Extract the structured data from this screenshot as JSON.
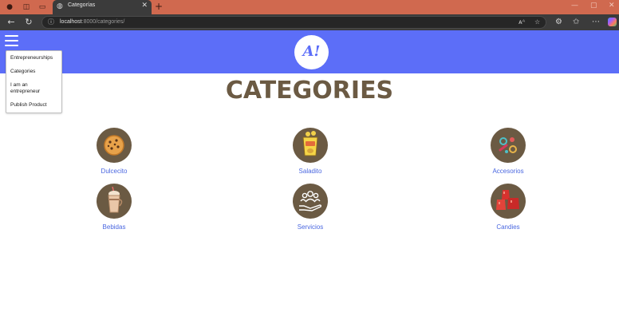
{
  "browser": {
    "tab_title": "Categorías",
    "url_host": "localhost",
    "url_path": ":8000/categories/",
    "new_tab_glyph": "+",
    "close_glyph": "✕"
  },
  "menu": {
    "items": [
      "Entrepreneurships",
      "Categories",
      "I am an",
      "entrepreneur",
      "Publish Product"
    ]
  },
  "logo_text": "A!",
  "page_title": "CATEGORIES",
  "categories": [
    {
      "label": "Dulcecito",
      "icon": "cookie-icon"
    },
    {
      "label": "Saladito",
      "icon": "chips-bag-icon"
    },
    {
      "label": "Accesorios",
      "icon": "accessories-icon"
    },
    {
      "label": "Bebidas",
      "icon": "milkshake-icon"
    },
    {
      "label": "Servicios",
      "icon": "people-hand-icon"
    },
    {
      "label": "Candies",
      "icon": "gummy-candies-icon"
    }
  ],
  "colors": {
    "header": "#5c6ef8",
    "title": "#6b5a43",
    "circle": "#6b5a43",
    "link": "#4a67e0",
    "tabbar": "#d0694f"
  }
}
